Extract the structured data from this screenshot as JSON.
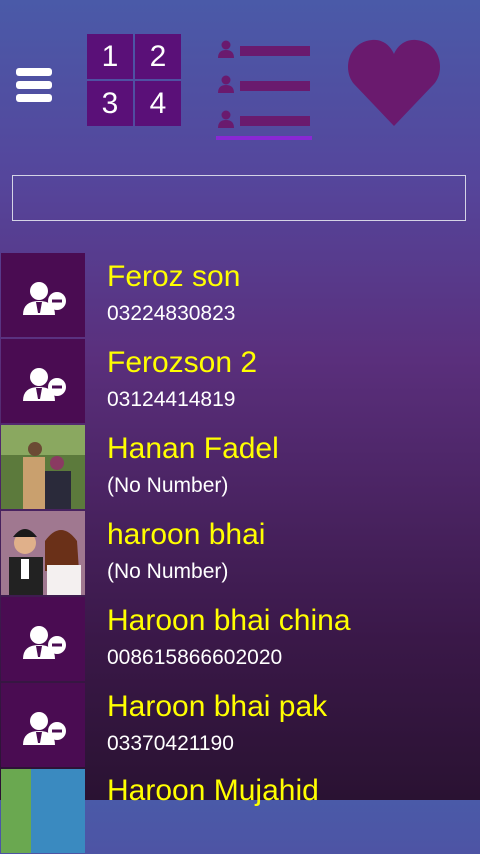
{
  "nav": {
    "menu_icon": "hamburger-icon",
    "grid_numbers": [
      "1",
      "2",
      "3",
      "4"
    ],
    "list_icon": "contact-list-icon",
    "favorites_icon": "heart-icon",
    "accent_color": "#8a28d4",
    "tile_color": "#5a1078"
  },
  "search": {
    "placeholder": ""
  },
  "contacts": [
    {
      "name": "Feroz son",
      "number": "03224830823",
      "avatar": "default-contact-icon"
    },
    {
      "name": "Ferozson 2",
      "number": "03124414819",
      "avatar": "default-contact-icon"
    },
    {
      "name": "Hanan Fadel",
      "number": "(No Number)",
      "avatar": "photo"
    },
    {
      "name": "haroon bhai",
      "number": "(No Number)",
      "avatar": "photo"
    },
    {
      "name": "Haroon bhai china",
      "number": "008615866602020",
      "avatar": "default-contact-icon"
    },
    {
      "name": "Haroon bhai pak",
      "number": "03370421190",
      "avatar": "default-contact-icon"
    },
    {
      "name": "Haroon Mujahid",
      "number": "",
      "avatar": "photo"
    }
  ],
  "colors": {
    "name_text": "#ffff00",
    "number_text": "#ffffff"
  }
}
